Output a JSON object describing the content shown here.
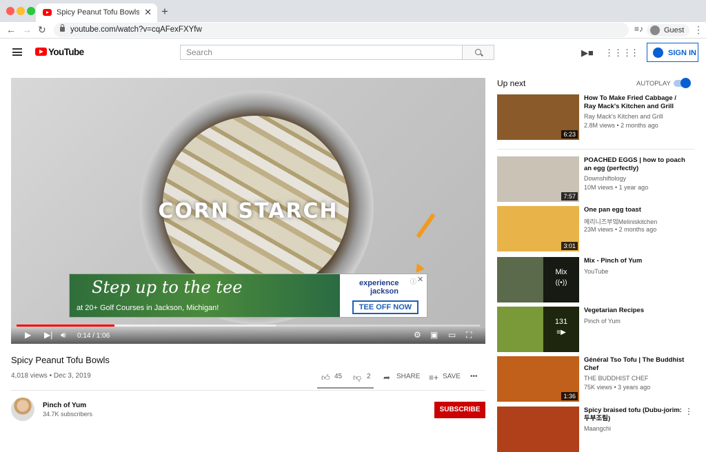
{
  "browser": {
    "tab_title": "Spicy Peanut Tofu Bowls - YouTube",
    "tab_close": "✕",
    "new_tab": "+",
    "url": "youtube.com/watch?v=cqAFexFXYfw",
    "profile": "Guest",
    "traffic_lights": [
      "#ff5f57",
      "#febc2e",
      "#28c840"
    ]
  },
  "header": {
    "logo_text": "YouTube",
    "search_placeholder": "Search",
    "sign_in": "SIGN IN"
  },
  "player": {
    "overlay_text": "CORN STARCH",
    "time": "0:14 / 1:06",
    "progress": 0.212,
    "buffered": 0.56,
    "ad": {
      "headline": "Step up to the tee",
      "subline": "at 20+ Golf Courses in Jackson, Michigan!",
      "brand_line1": "experience",
      "brand_line2": "jackson",
      "cta": "TEE OFF NOW",
      "info": "ⓘ",
      "close": "✕"
    }
  },
  "video": {
    "title": "Spicy Peanut Tofu Bowls",
    "meta": "4,018 views • Dec 3, 2019",
    "likes": "45",
    "dislikes": "2",
    "share": "SHARE",
    "save": "SAVE",
    "more": "•••"
  },
  "channel": {
    "name": "Pinch of Yum",
    "subs": "34.7K subscribers",
    "subscribe": "SUBSCRIBE"
  },
  "sidebar": {
    "up_next": "Up next",
    "autoplay": "AUTOPLAY",
    "autoplay_on": true,
    "items": [
      {
        "title": "How To Make Fried Cabbage / Ray Mack's Kitchen and Grill",
        "channel": "Ray Mack's Kitchen and Grill",
        "views": "2.8M views • 2 months ago",
        "duration": "6:23",
        "color": "#8a5a2a"
      },
      {
        "title": "POACHED EGGS | how to poach an egg (perfectly)",
        "channel": "Downshiftology",
        "views": "10M views • 1 year ago",
        "duration": "7:57",
        "color": "#c9c2b5"
      },
      {
        "title": "One pan egg toast",
        "channel": "메리니즈부엌Meliniskitchen",
        "views": "23M views • 2 months ago",
        "duration": "3:01",
        "color": "#e8b44a"
      },
      {
        "title": "Mix - Pinch of Yum",
        "channel": "YouTube",
        "views": "",
        "playlist_label": "Mix",
        "playlist_glyph": "((•))",
        "color": "#5a6a4a"
      },
      {
        "title": "Vegetarian Recipes",
        "channel": "Pinch of Yum",
        "views": "",
        "playlist_label": "131",
        "playlist_glyph": "≡▶",
        "color": "#7a9a3a"
      },
      {
        "title": "Général Tso Tofu | The Buddhist Chef",
        "channel": "THE BUDDHIST CHEF",
        "views": "75K views • 3 years ago",
        "duration": "1:36",
        "color": "#c0601a"
      },
      {
        "title": "Spicy braised tofu (Dubu-jorim: 두부조림)",
        "channel": "Maangchi",
        "views": "",
        "color": "#b0401a"
      }
    ]
  }
}
